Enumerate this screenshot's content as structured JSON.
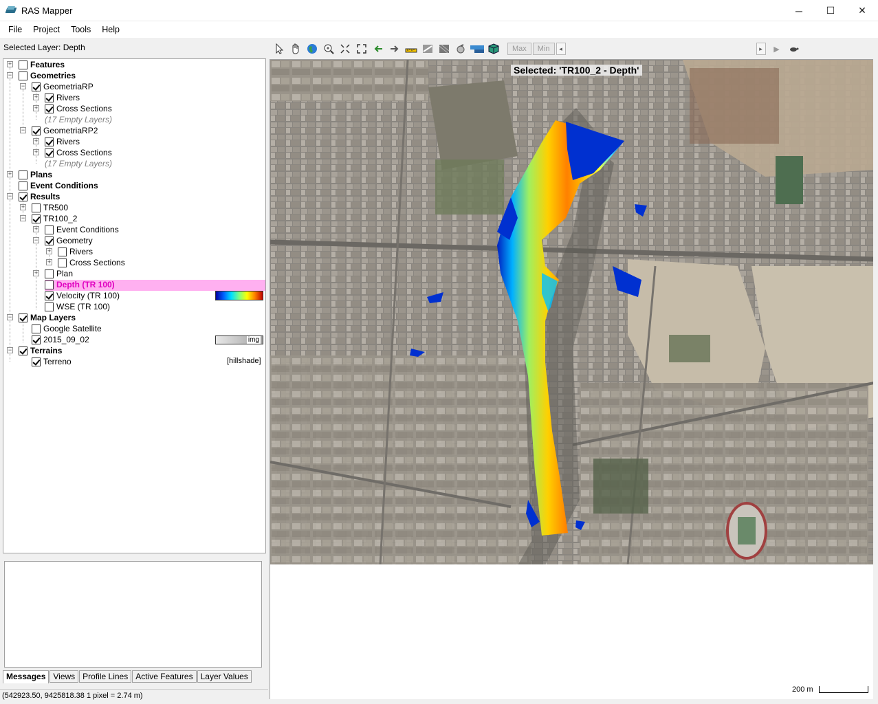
{
  "window": {
    "title": "RAS Mapper",
    "minimize_glyph": "─",
    "maximize_glyph": "☐",
    "close_glyph": "✕"
  },
  "menu": [
    "File",
    "Project",
    "Tools",
    "Help"
  ],
  "selected_layer_text": "Selected Layer: Depth",
  "toolbar": {
    "icons": [
      "pointer-icon",
      "pan-hand-icon",
      "globe-icon",
      "zoom-in-icon",
      "zoom-extents-icon",
      "full-extent-icon",
      "back-arrow-icon",
      "forward-arrow-icon",
      "measure-ruler-icon",
      "profile-line-icon",
      "raster-icon",
      "plot-icon",
      "terrain-profile-icon",
      "3d-cube-icon"
    ],
    "max_label": "Max",
    "min_label": "Min",
    "slider_left_glyph": "◂",
    "slider_right_glyph": "▸",
    "play_glyph": "▶",
    "turtle_glyph": "🐢"
  },
  "tree": {
    "features": "Features",
    "geometries": "Geometries",
    "geom1": "GeometriaRP",
    "geom1_rivers": "Rivers",
    "geom1_xs": "Cross Sections",
    "geom1_empty": "(17 Empty Layers)",
    "geom2": "GeometriaRP2",
    "geom2_rivers": "Rivers",
    "geom2_xs": "Cross Sections",
    "geom2_empty": "(17 Empty Layers)",
    "plans": "Plans",
    "event_conditions": "Event Conditions",
    "results": "Results",
    "tr500": "TR500",
    "tr100": "TR100_2",
    "tr100_event": "Event Conditions",
    "tr100_geometry": "Geometry",
    "tr100_geom_rivers": "Rivers",
    "tr100_geom_xs": "Cross Sections",
    "tr100_plan": "Plan",
    "depth": "Depth (TR 100)",
    "velocity": "Velocity (TR 100)",
    "wse": "WSE (TR 100)",
    "map_layers": "Map Layers",
    "google_sat": "Google Satellite",
    "img_2015": "2015_09_02",
    "img_tag": "img",
    "terrains": "Terrains",
    "terreno": "Terreno",
    "hillshade_tag": "[hillshade]"
  },
  "tabs": [
    "Messages",
    "Views",
    "Profile Lines",
    "Active Features",
    "Layer Values"
  ],
  "status": "(542923.50, 9425818.38  1 pixel = 2.74 m)",
  "map": {
    "title": "Selected: 'TR100_2 - Depth'",
    "scale_label": "200 m",
    "colors": {
      "deep": "#e03000",
      "mid": "#ffd000",
      "shallow": "#00d0ff",
      "edge": "#0020c0"
    }
  }
}
